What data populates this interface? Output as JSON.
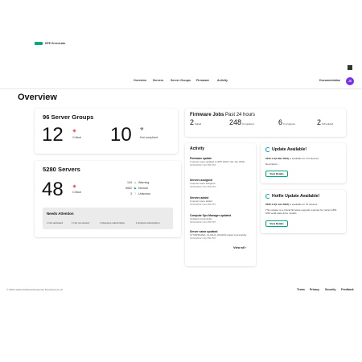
{
  "brand": {
    "name": "HPE GreenLake",
    "logo_color": "#01a982"
  },
  "header": {
    "nav": [
      "Overview",
      "Servers",
      "Server Groups",
      "Firmware",
      "Activity"
    ],
    "documentation": "Documentation",
    "avatar_initials": "JS",
    "avatar_color": "#7630ea",
    "apps_icon": "app-grid-icon"
  },
  "page_title": "Overview",
  "server_groups": {
    "title": "96 Server Groups",
    "critical_count": "12",
    "critical_label": "Critical",
    "noncompliant_count": "10",
    "noncompliant_label": "Not compliant"
  },
  "servers": {
    "title": "5280 Servers",
    "critical_count": "48",
    "critical_label": "Critical",
    "statuses": [
      {
        "count": "144",
        "label": "Warning"
      },
      {
        "count": "5502",
        "label": "Normal"
      },
      {
        "count": "3",
        "label": "Unknown"
      }
    ],
    "needs_attention": {
      "title": "Needs Attention",
      "items": [
        "1 Not activated",
        "1 Not connected",
        "1 Requires subscription",
        "1 Expired subscription"
      ]
    }
  },
  "firmware_jobs": {
    "title": "Firmware Jobs",
    "period": "Past 24 hours",
    "stats": [
      {
        "count": "2",
        "label": "Failed"
      },
      {
        "count": "248",
        "label": "Completed"
      },
      {
        "count": "6",
        "label": "In progress"
      },
      {
        "count": "2",
        "label": "Scheduled"
      }
    ]
  },
  "activity": {
    "title": "Activity",
    "items": [
      {
        "title": "Firmware update",
        "desc": "3 servers were updated to SPP 2022.1.0(1 Jan 2022)",
        "time": "01/01/2022 3:22 PM PST"
      },
      {
        "title": "Servers assigned",
        "desc": "3 servers were assigned",
        "time": "01/01/2022 3:22 PM PST"
      },
      {
        "title": "Servers added",
        "desc": "3 servers were added",
        "time": "01/01/2022 3:22 PM PST"
      },
      {
        "title": "Compute Ops Manager updated",
        "desc": "Updated successfully.",
        "time": "01/01/2022 3:22 PM PST"
      },
      {
        "title": "Server name updated",
        "desc": "SYSRPRAZEA_KLASH4_20A4030 edited successfully.",
        "time": "01/01/2022 3:22 PM PST"
      }
    ],
    "view_all": "View all"
  },
  "update_available": {
    "title": "Update Available!",
    "line_bold": "2022.1.0(1 Mar 2022)",
    "line_rest": " is available for 173 devices.",
    "desc": "Description...",
    "button": "View Details"
  },
  "hotfix_update": {
    "title": "Hotfix Update Available!",
    "line_bold": "2022.1.3(1 Jun 2022)",
    "line_rest": " is available for 16 devices.",
    "desc": "This release is a critical firmware upgrade required for certain HPE SSD solid-state drive models.",
    "button": "View Details"
  },
  "footer": {
    "copyright": "© 2022 Hewlett Packard Enterprise Development LP",
    "links": [
      "Terms",
      "Privacy",
      "Security",
      "Feedback"
    ]
  },
  "colors": {
    "critical": "#fc5a5a",
    "brand_green": "#01a982",
    "sync_blue": "#00a1c9"
  }
}
